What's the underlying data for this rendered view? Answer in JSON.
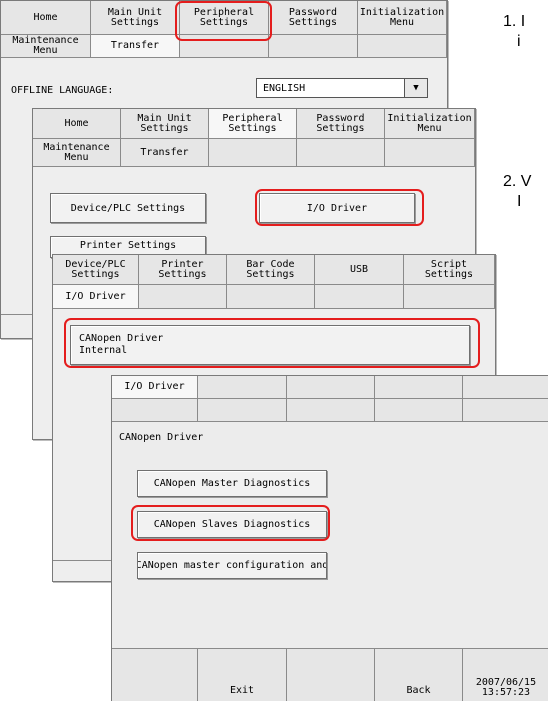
{
  "steps": {
    "step1": "1. I",
    "step1_cont": "i",
    "step2": "2. V",
    "step2_cont": "I"
  },
  "screen1": {
    "tabs_row1": [
      "Home",
      "Main Unit\nSettings",
      "Peripheral\nSettings",
      "Password\nSettings",
      "Initialization\nMenu"
    ],
    "tabs_row2": [
      "Maintenance\nMenu",
      "Transfer",
      "",
      "",
      ""
    ],
    "offline_language_label": "OFFLINE LANGUAGE:",
    "offline_language_value": "ENGLISH"
  },
  "screen2": {
    "tabs_row1": [
      "Home",
      "Main Unit\nSettings",
      "Peripheral\nSettings",
      "Password\nSettings",
      "Initialization\nMenu"
    ],
    "tabs_row2": [
      "Maintenance\nMenu",
      "Transfer",
      "",
      "",
      ""
    ],
    "device_plc_button": "Device/PLC Settings",
    "io_driver_button": "I/O Driver",
    "printer_settings_button": "Printer Settings"
  },
  "screen3": {
    "tabs_row1": [
      "Device/PLC\nSettings",
      "Printer\nSettings",
      "Bar Code\nSettings",
      "USB",
      "Script\nSettings"
    ],
    "tabs_row2": [
      "I/O Driver",
      "",
      "",
      "",
      ""
    ],
    "canopen_driver_button_line1": "CANopen Driver",
    "canopen_driver_button_line2": "Internal"
  },
  "screen4": {
    "tabs_row1": [
      "I/O Driver",
      "",
      "",
      "",
      ""
    ],
    "tabs_row2": [
      "",
      "",
      "",
      "",
      ""
    ],
    "section_label": "CANopen Driver",
    "master_diag_button": "CANopen Master Diagnostics",
    "slaves_diag_button": "CANopen Slaves Diagnostics",
    "master_config_button": "CANopen master configuration and",
    "footer": {
      "exit": "Exit",
      "back": "Back",
      "date": "2007/06/15",
      "time": "13:57:23"
    }
  },
  "colors": {
    "highlight": "#e41d1d",
    "panel": "#eeeeee",
    "border": "#7a7a7a"
  }
}
